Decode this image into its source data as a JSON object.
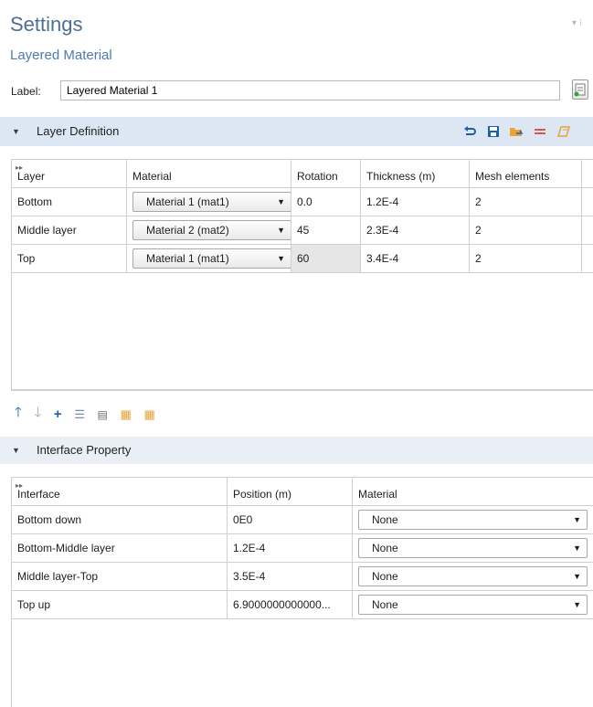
{
  "header": {
    "title": "Settings",
    "subtitle": "Layered Material"
  },
  "label": {
    "caption": "Label:",
    "value": "Layered Material 1"
  },
  "layer_definition": {
    "title": "Layer Definition",
    "columns": [
      "Layer",
      "Material",
      "Rotation",
      "Thickness (m)",
      "Mesh elements"
    ],
    "rows": [
      {
        "layer": "Bottom",
        "material": "Material 1 (mat1)",
        "rotation": "0.0",
        "thickness": "1.2E-4",
        "mesh": "2"
      },
      {
        "layer": "Middle layer",
        "material": "Material 2 (mat2)",
        "rotation": "45",
        "thickness": "2.3E-4",
        "mesh": "2"
      },
      {
        "layer": "Top",
        "material": "Material 1 (mat1)",
        "rotation": "60",
        "thickness": "3.4E-4",
        "mesh": "2"
      }
    ],
    "toolbar_icons": [
      "undo-icon",
      "save-icon",
      "load-icon",
      "clear-icon",
      "layers-icon"
    ]
  },
  "table_toolbar": [
    "move-up-icon",
    "move-down-icon",
    "add-icon",
    "delete-icon",
    "import-icon",
    "layer-add-icon",
    "layer-grid-icon"
  ],
  "interface_property": {
    "title": "Interface Property",
    "columns": [
      "Interface",
      "Position (m)",
      "Material"
    ],
    "rows": [
      {
        "interface": "Bottom down",
        "position": "0E0",
        "material": "None"
      },
      {
        "interface": "Bottom-Middle layer",
        "position": "1.2E-4",
        "material": "None"
      },
      {
        "interface": "Middle layer-Top",
        "position": "3.5E-4",
        "material": "None"
      },
      {
        "interface": "Top up",
        "position": "6.9000000000000...",
        "material": "None"
      }
    ]
  },
  "colors": {
    "title": "#4d6f94",
    "section_bar": "#dde7f3",
    "accent_blue": "#1f5fa8",
    "orange": "#e8a43a"
  }
}
